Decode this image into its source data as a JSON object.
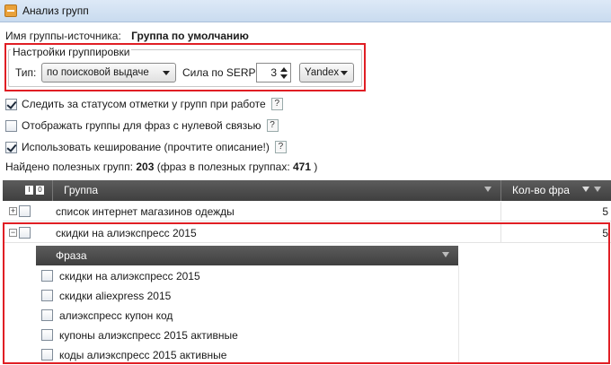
{
  "window": {
    "title": "Анализ групп"
  },
  "source": {
    "label": "Имя группы-источника:",
    "value": "Группа по умолчанию"
  },
  "grouping": {
    "legend": "Настройки группировки",
    "type_label": "Тип:",
    "type_value": "по поисковой выдаче",
    "serp_label": "Сила по SERP:",
    "serp_value": "3",
    "engine_value": "Yandex"
  },
  "options": [
    {
      "label": "Следить за статусом отметки у групп при работе",
      "checked": true,
      "help": "?"
    },
    {
      "label": "Отображать группы для фраз с нулевой связью",
      "checked": false,
      "help": "?"
    },
    {
      "label": "Использовать кеширование (прочтите описание!)",
      "checked": true,
      "help": "?"
    }
  ],
  "summary": {
    "prefix": "Найдено полезных групп: ",
    "groups_count": "203",
    "middle": " (фраз в полезных группах: ",
    "phrases_count": "471",
    "suffix": " )"
  },
  "grid": {
    "columns": {
      "group": "Группа",
      "count": "Кол-во фра"
    },
    "rows": [
      {
        "name": "список интернет магазинов одежды",
        "count": "5",
        "expanded": false
      },
      {
        "name": "скидки на алиэкспресс 2015",
        "count": "5",
        "expanded": true
      }
    ]
  },
  "subgrid": {
    "column": "Фраза",
    "phrases": [
      "скидки на алиэкспресс 2015",
      "скидки aliexpress 2015",
      "алиэкспресс купон код",
      "купоны алиэкспресс 2015 активные",
      "коды алиэкспресс 2015 активные"
    ]
  },
  "colors": {
    "highlight": "#e01e24",
    "header_bg": "#4a4a4a"
  }
}
